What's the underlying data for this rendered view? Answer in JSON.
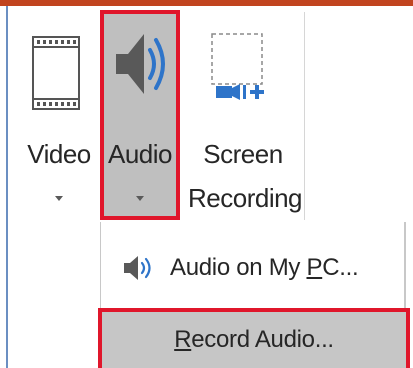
{
  "ribbon": {
    "buttons": [
      {
        "id": "video",
        "label": "Video",
        "icon": "film-strip-icon",
        "has_dropdown": true
      },
      {
        "id": "audio",
        "label": "Audio",
        "icon": "speaker-icon",
        "has_dropdown": true,
        "highlighted": true
      },
      {
        "id": "screen_recording",
        "label_line1": "Screen",
        "label_line2": "Recording",
        "icon": "screen-recording-icon",
        "has_dropdown": false
      }
    ]
  },
  "audio_menu": {
    "items": [
      {
        "label_pre": "Audio on My ",
        "mnemonic": "P",
        "label_post": "C...",
        "icon": "speaker-icon"
      },
      {
        "label_pre": "",
        "mnemonic": "R",
        "label_post": "ecord Audio...",
        "highlighted": true
      }
    ]
  },
  "colors": {
    "accent_red": "#e0162b",
    "title_bar": "#c1441f",
    "audio_blue": "#2e74c9",
    "highlight_gray": "#c6c6c6"
  }
}
